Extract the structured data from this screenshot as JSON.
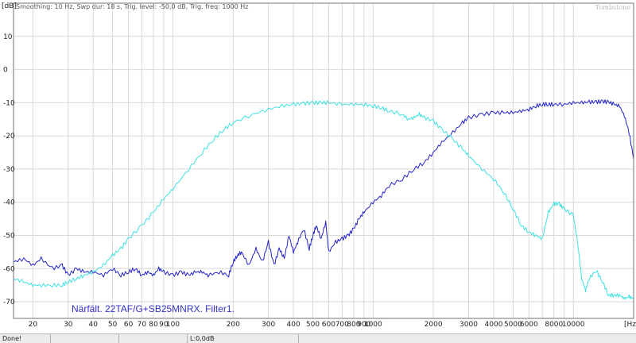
{
  "header": {
    "unit_y": "[dB]",
    "info": "Smoothing: 10 Hz, Swp dur: 18 s, Trig. level: -50,0 dB, Trig. freq: 1000 Hz",
    "brand": "Tombstone"
  },
  "status": {
    "left": "Done!",
    "level": "L:0,0dB"
  },
  "colors": {
    "woofer": "#2424c8",
    "tweeter": "#40e0e0",
    "grid": "#d8d8d8",
    "axis": "#707070"
  },
  "chart_data": {
    "type": "line",
    "title": "",
    "xlabel": "[Hz]",
    "ylabel": "[dB]",
    "x_scale": "log",
    "xlim": [
      16,
      20000
    ],
    "ylim": [
      -75,
      20
    ],
    "grid": true,
    "annotation": "Närfält. 22TAF/G+SB25MNRX. Filter1.",
    "x_ticks": [
      {
        "value": 20,
        "label": "20"
      },
      {
        "value": 30,
        "label": "30"
      },
      {
        "value": 40,
        "label": "40"
      },
      {
        "value": 50,
        "label": "50"
      },
      {
        "value": 60,
        "label": "60"
      },
      {
        "value": 70,
        "label": "70"
      },
      {
        "value": 80,
        "label": "80"
      },
      {
        "value": 90,
        "label": "90"
      },
      {
        "value": 100,
        "label": "100"
      },
      {
        "value": 200,
        "label": "200"
      },
      {
        "value": 300,
        "label": "300"
      },
      {
        "value": 400,
        "label": "400"
      },
      {
        "value": 500,
        "label": "500"
      },
      {
        "value": 600,
        "label": "600"
      },
      {
        "value": 700,
        "label": "700"
      },
      {
        "value": 800,
        "label": "800"
      },
      {
        "value": 900,
        "label": "900"
      },
      {
        "value": 1000,
        "label": "1000"
      },
      {
        "value": 2000,
        "label": "2000"
      },
      {
        "value": 3000,
        "label": "3000"
      },
      {
        "value": 4000,
        "label": "4000"
      },
      {
        "value": 5000,
        "label": "5000"
      },
      {
        "value": 6000,
        "label": "6000"
      },
      {
        "value": 8000,
        "label": "8000"
      },
      {
        "value": 10000,
        "label": "10000"
      }
    ],
    "y_ticks": [
      10,
      0,
      -10,
      -20,
      -30,
      -40,
      -50,
      -60,
      -70
    ],
    "series": [
      {
        "color": "#2424c8",
        "x": [
          16,
          18,
          20,
          22,
          25,
          28,
          30,
          33,
          36,
          40,
          45,
          50,
          55,
          60,
          65,
          70,
          75,
          80,
          85,
          90,
          100,
          110,
          120,
          130,
          140,
          150,
          170,
          190,
          200,
          210,
          220,
          240,
          260,
          280,
          300,
          320,
          340,
          360,
          380,
          400,
          420,
          450,
          480,
          500,
          520,
          550,
          580,
          600,
          650,
          700,
          750,
          800,
          850,
          900,
          1000,
          1100,
          1200,
          1400,
          1600,
          1800,
          2000,
          2200,
          2500,
          2800,
          3000,
          3500,
          4000,
          4500,
          5000,
          5500,
          6000,
          6500,
          7000,
          7500,
          8000,
          9000,
          10000,
          11000,
          12000,
          13000,
          14000,
          15000,
          16000,
          17000,
          18000,
          19000,
          20000
        ],
        "y": [
          -58,
          -57,
          -59,
          -57,
          -60,
          -59,
          -62,
          -60,
          -61,
          -61,
          -62,
          -60,
          -62,
          -61,
          -60,
          -62,
          -61,
          -62,
          -60,
          -61,
          -62,
          -61,
          -62,
          -61,
          -61,
          -62,
          -61,
          -62,
          -58,
          -56,
          -55,
          -59,
          -54,
          -58,
          -52,
          -59,
          -54,
          -57,
          -50,
          -55,
          -52,
          -48,
          -54,
          -50,
          -47,
          -51,
          -46,
          -55,
          -52,
          -51,
          -50,
          -48,
          -45,
          -43,
          -40,
          -38,
          -35,
          -33,
          -30,
          -28,
          -25,
          -22,
          -19,
          -16,
          -14.5,
          -13.5,
          -13,
          -13,
          -13,
          -12.5,
          -12,
          -11,
          -10.5,
          -10.5,
          -10.5,
          -10.5,
          -10,
          -10,
          -9.8,
          -9.8,
          -9.6,
          -9.8,
          -10.5,
          -11,
          -14,
          -19,
          -27
        ]
      },
      {
        "color": "#40e0e0",
        "x": [
          16,
          18,
          20,
          22,
          25,
          28,
          30,
          33,
          36,
          40,
          45,
          50,
          55,
          60,
          70,
          80,
          90,
          100,
          120,
          140,
          160,
          180,
          200,
          250,
          300,
          350,
          400,
          450,
          500,
          550,
          600,
          700,
          800,
          900,
          1000,
          1100,
          1200,
          1400,
          1500,
          1600,
          1700,
          1800,
          2000,
          2200,
          2500,
          2800,
          3000,
          3500,
          4000,
          4500,
          5000,
          5500,
          6000,
          6500,
          7000,
          7500,
          8000,
          8500,
          9000,
          10000,
          10500,
          11000,
          11500,
          12000,
          13000,
          14000,
          15000,
          16000,
          17000,
          18000,
          19000,
          20000
        ],
        "y": [
          -63,
          -64,
          -65,
          -65,
          -65,
          -65,
          -64,
          -63,
          -62,
          -61,
          -59,
          -56,
          -54,
          -51,
          -47,
          -43,
          -39,
          -36,
          -30,
          -25,
          -21,
          -18,
          -16,
          -13.5,
          -12,
          -11,
          -10.5,
          -10.2,
          -10,
          -10,
          -10,
          -10.5,
          -10.5,
          -10.5,
          -11,
          -11.5,
          -12.5,
          -13.5,
          -15,
          -14.5,
          -13.5,
          -14.5,
          -15.5,
          -18,
          -21,
          -24,
          -26,
          -30,
          -33,
          -37,
          -42,
          -47,
          -49,
          -50,
          -51,
          -43,
          -40.5,
          -40.5,
          -42,
          -44,
          -52,
          -63,
          -66.5,
          -63,
          -60.5,
          -64,
          -68,
          -68,
          -68,
          -69,
          -68.5,
          -69
        ]
      }
    ]
  }
}
